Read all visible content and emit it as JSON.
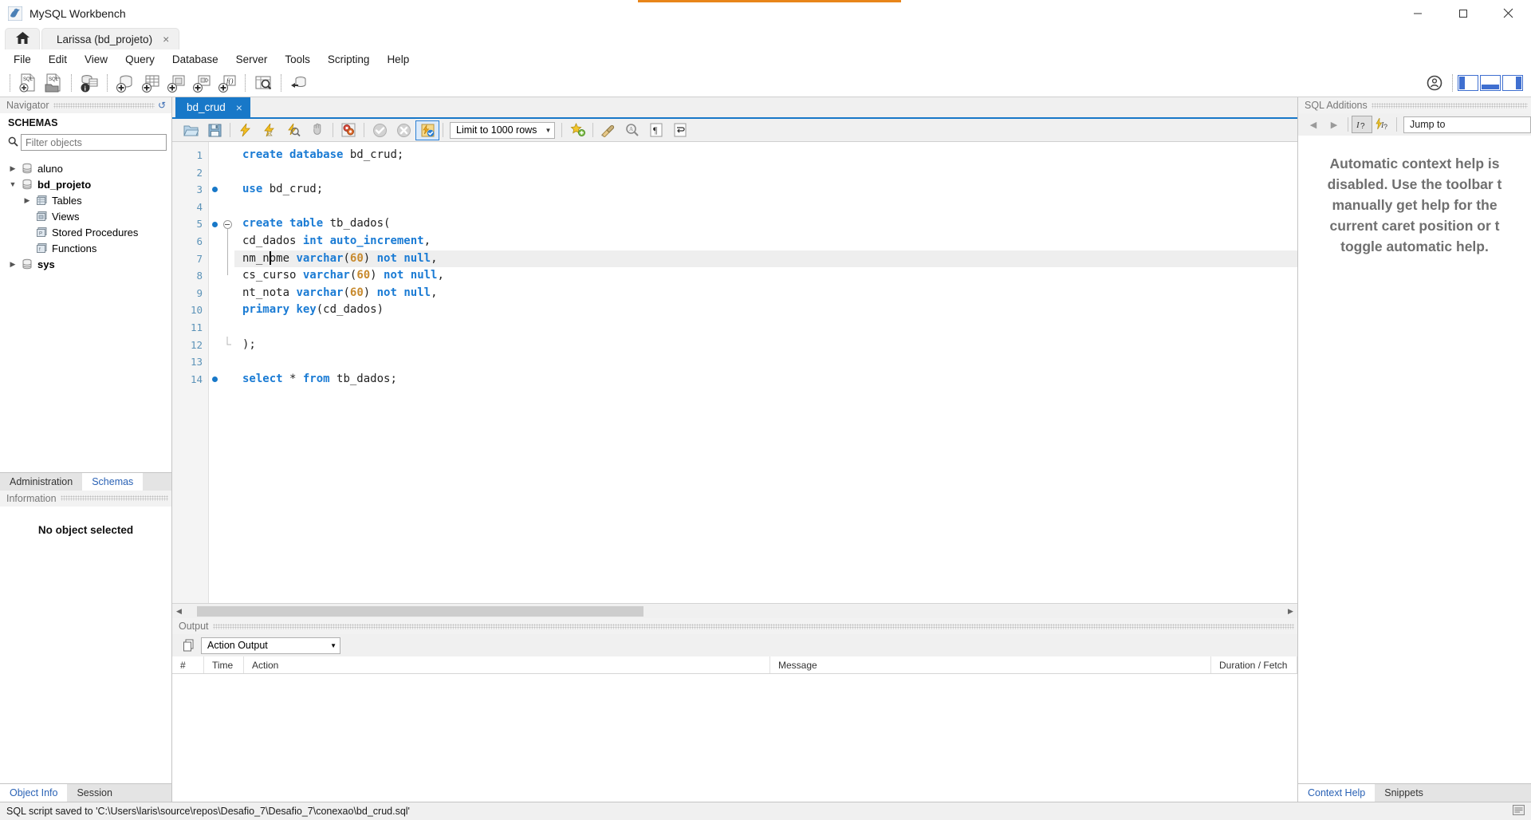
{
  "window": {
    "title": "MySQL Workbench",
    "app_icon": "dolphin-icon",
    "minimize": "minimize-button",
    "maximize": "maximize-button",
    "close": "close-button"
  },
  "tabs": {
    "home_label": "home-icon",
    "connection_tab": "Larissa (bd_projeto)",
    "close_glyph": "×"
  },
  "menu": {
    "items": [
      "File",
      "Edit",
      "View",
      "Query",
      "Database",
      "Server",
      "Tools",
      "Scripting",
      "Help"
    ]
  },
  "main_toolbar": {
    "buttons": [
      {
        "name": "new-sql-tab-icon",
        "label": "SQL"
      },
      {
        "name": "open-sql-script-icon",
        "label": "SQL"
      },
      {
        "name": "connection-info-icon",
        "label": ""
      },
      {
        "name": "create-schema-icon",
        "label": ""
      },
      {
        "name": "create-table-icon",
        "label": ""
      },
      {
        "name": "create-view-icon",
        "label": ""
      },
      {
        "name": "create-procedure-icon",
        "label": ""
      },
      {
        "name": "create-function-icon",
        "label": ""
      },
      {
        "name": "inspect-table-icon",
        "label": ""
      },
      {
        "name": "reconnect-server-icon",
        "label": ""
      }
    ],
    "right": {
      "account_icon": "account-circle-icon",
      "layout_buttons": [
        "sidebar-layout-left",
        "sidebar-layout-bottom",
        "sidebar-layout-right"
      ]
    }
  },
  "navigator": {
    "caption": "Navigator",
    "refresh_icon": "refresh-icon",
    "schemas_header": "SCHEMAS",
    "filter_placeholder": "Filter objects",
    "filter_value": "",
    "search_icon": "search-icon",
    "tree": [
      {
        "label": "aluno",
        "icon": "database-icon",
        "expanded": false,
        "depth": 0,
        "bold": false
      },
      {
        "label": "bd_projeto",
        "icon": "database-icon",
        "expanded": true,
        "depth": 0,
        "bold": true
      },
      {
        "label": "Tables",
        "icon": "folder-tables-icon",
        "expanded": false,
        "depth": 1,
        "bold": false
      },
      {
        "label": "Views",
        "icon": "folder-views-icon",
        "expanded": null,
        "depth": 1,
        "bold": false
      },
      {
        "label": "Stored Procedures",
        "icon": "folder-procedures-icon",
        "expanded": null,
        "depth": 1,
        "bold": false
      },
      {
        "label": "Functions",
        "icon": "folder-functions-icon",
        "expanded": null,
        "depth": 1,
        "bold": false
      },
      {
        "label": "sys",
        "icon": "database-icon",
        "expanded": false,
        "depth": 0,
        "bold": false
      }
    ],
    "bottom_tabs": [
      {
        "label": "Administration",
        "active": false
      },
      {
        "label": "Schemas",
        "active": true
      }
    ],
    "information_caption": "Information",
    "information_message": "No object selected",
    "info_tabs": [
      {
        "label": "Object Info",
        "active": true
      },
      {
        "label": "Session",
        "active": false
      }
    ]
  },
  "editor": {
    "tab_label": "bd_crud",
    "tab_close": "×",
    "toolbar": {
      "open_script": "open-script-icon",
      "save_script": "save-script-icon",
      "execute": "execute-icon",
      "execute_current": "execute-current-statement-icon",
      "explain": "explain-plan-icon",
      "stop": "stop-execution-icon",
      "toggle_stop_on_error": "stop-on-error-icon",
      "commit": "commit-icon",
      "rollback": "rollback-icon",
      "autocommit": "toggle-autocommit-icon",
      "limit_label": "Limit to 1000 rows",
      "caret": "▼",
      "snippet": "save-snippet-icon",
      "beautify": "beautify-sql-icon",
      "find": "find-icon",
      "invisible_chars": "toggle-invisible-characters-icon",
      "wrap_lines": "toggle-word-wrap-icon"
    },
    "lines": [
      {
        "n": 1,
        "marker": false,
        "text": "create database bd_crud;",
        "tokens": [
          [
            "kw",
            "create"
          ],
          [
            "sp",
            " "
          ],
          [
            "kw",
            "database"
          ],
          [
            "sp",
            " "
          ],
          [
            "id",
            "bd_crud;"
          ]
        ]
      },
      {
        "n": 2,
        "marker": false,
        "text": "",
        "tokens": []
      },
      {
        "n": 3,
        "marker": true,
        "text": "use bd_crud;",
        "tokens": [
          [
            "kw",
            "use"
          ],
          [
            "sp",
            " "
          ],
          [
            "id",
            "bd_crud;"
          ]
        ]
      },
      {
        "n": 4,
        "marker": false,
        "text": "",
        "tokens": []
      },
      {
        "n": 5,
        "marker": true,
        "text": "create table tb_dados(",
        "tokens": [
          [
            "kw",
            "create"
          ],
          [
            "sp",
            " "
          ],
          [
            "kw",
            "table"
          ],
          [
            "sp",
            " "
          ],
          [
            "id",
            "tb_dados("
          ]
        ]
      },
      {
        "n": 6,
        "marker": false,
        "text": "cd_dados int auto_increment,",
        "tokens": [
          [
            "id",
            "cd_dados "
          ],
          [
            "kw",
            "int"
          ],
          [
            "sp",
            " "
          ],
          [
            "kw",
            "auto_increment"
          ],
          [
            "id",
            ","
          ]
        ]
      },
      {
        "n": 7,
        "marker": false,
        "text": "nm_nome varchar(60) not null,",
        "tokens": [
          [
            "id",
            "nm_nome "
          ],
          [
            "kw",
            "varchar"
          ],
          [
            "id",
            "("
          ],
          [
            "num",
            "60"
          ],
          [
            "id",
            ") "
          ],
          [
            "kw",
            "not"
          ],
          [
            "sp",
            " "
          ],
          [
            "kw",
            "null"
          ],
          [
            "id",
            ","
          ]
        ]
      },
      {
        "n": 8,
        "marker": false,
        "text": "cs_curso varchar(60) not null,",
        "tokens": [
          [
            "id",
            "cs_curso "
          ],
          [
            "kw",
            "varchar"
          ],
          [
            "id",
            "("
          ],
          [
            "num",
            "60"
          ],
          [
            "id",
            ") "
          ],
          [
            "kw",
            "not"
          ],
          [
            "sp",
            " "
          ],
          [
            "kw",
            "null"
          ],
          [
            "id",
            ","
          ]
        ]
      },
      {
        "n": 9,
        "marker": false,
        "text": "nt_nota varchar(60) not null,",
        "tokens": [
          [
            "id",
            "nt_nota "
          ],
          [
            "kw",
            "varchar"
          ],
          [
            "id",
            "("
          ],
          [
            "num",
            "60"
          ],
          [
            "id",
            ") "
          ],
          [
            "kw",
            "not"
          ],
          [
            "sp",
            " "
          ],
          [
            "kw",
            "null"
          ],
          [
            "id",
            ","
          ]
        ]
      },
      {
        "n": 10,
        "marker": false,
        "text": "primary key(cd_dados)",
        "tokens": [
          [
            "kw",
            "primary"
          ],
          [
            "sp",
            " "
          ],
          [
            "kw",
            "key"
          ],
          [
            "id",
            "(cd_dados)"
          ]
        ]
      },
      {
        "n": 11,
        "marker": false,
        "text": "",
        "tokens": []
      },
      {
        "n": 12,
        "marker": false,
        "text": ");",
        "tokens": [
          [
            "id",
            ");"
          ]
        ]
      },
      {
        "n": 13,
        "marker": false,
        "text": "",
        "tokens": []
      },
      {
        "n": 14,
        "marker": true,
        "text": "select * from tb_dados;",
        "tokens": [
          [
            "kw",
            "select"
          ],
          [
            "sp",
            " "
          ],
          [
            "id",
            "* "
          ],
          [
            "kw",
            "from"
          ],
          [
            "sp",
            " "
          ],
          [
            "id",
            "tb_dados;"
          ]
        ]
      }
    ],
    "current_line": 7,
    "caret_line": 7,
    "caret_column": 4
  },
  "output": {
    "caption": "Output",
    "copy_icon": "copy-icon",
    "selected_view": "Action Output",
    "caret": "▼",
    "columns": [
      "#",
      "Time",
      "Action",
      "Message",
      "Duration / Fetch"
    ],
    "rows": []
  },
  "sql_additions": {
    "caption": "SQL Additions",
    "back_icon": "◀",
    "forward_icon": "▶",
    "manual_help_icon": "context-help-icon",
    "auto_help_icon": "automatic-help-toggle-icon",
    "jump_to_label": "Jump to",
    "help_text": "Automatic context help is disabled. Use the toolbar to manually get help for the current caret position or to toggle automatic help.",
    "help_lines": [
      "Automatic context help is",
      "disabled. Use the toolbar t",
      "manually get help for the",
      "current caret position or t",
      "toggle automatic help."
    ],
    "tabs": [
      {
        "label": "Context Help",
        "active": true
      },
      {
        "label": "Snippets",
        "active": false
      }
    ]
  },
  "statusbar": {
    "message": "SQL script saved to 'C:\\Users\\laris\\source\\repos\\Desafio_7\\Desafio_7\\conexao\\bd_crud.sql'",
    "right_icon": "output-indicator-icon"
  },
  "colors": {
    "accent_blue": "#1878c8",
    "keyword_blue": "#1a7bd4",
    "number_orange": "#c88a2e",
    "link_blue": "#2a62b5",
    "title_accent": "#e8851a"
  }
}
